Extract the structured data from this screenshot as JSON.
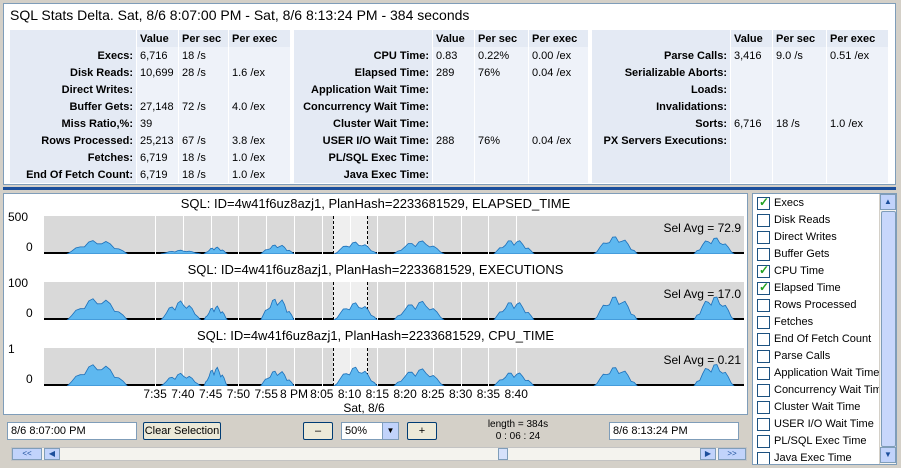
{
  "header": {
    "title": "SQL Stats Delta. Sat, 8/6 8:07:00 PM - Sat, 8/6 8:13:24 PM - 384 seconds"
  },
  "stats": {
    "col_headers": [
      "Value",
      "Per sec",
      "Per exec"
    ],
    "group1": [
      {
        "label": "Execs:",
        "value": "6,716",
        "per_sec": "18 /s",
        "per_exec": ""
      },
      {
        "label": "Disk Reads:",
        "value": "10,699",
        "per_sec": "28 /s",
        "per_exec": "1.6 /ex"
      },
      {
        "label": "Direct Writes:",
        "value": "",
        "per_sec": "",
        "per_exec": ""
      },
      {
        "label": "Buffer Gets:",
        "value": "27,148",
        "per_sec": "72 /s",
        "per_exec": "4.0 /ex"
      },
      {
        "label": "Miss Ratio,%:",
        "value": "39",
        "per_sec": "",
        "per_exec": ""
      },
      {
        "label": "Rows Processed:",
        "value": "25,213",
        "per_sec": "67 /s",
        "per_exec": "3.8 /ex"
      },
      {
        "label": "Fetches:",
        "value": "6,719",
        "per_sec": "18 /s",
        "per_exec": "1.0 /ex"
      },
      {
        "label": "End Of Fetch Count:",
        "value": "6,719",
        "per_sec": "18 /s",
        "per_exec": "1.0 /ex"
      }
    ],
    "group2": [
      {
        "label": "CPU Time:",
        "value": "0.83",
        "per_sec": "0.22%",
        "per_exec": "0.00 /ex"
      },
      {
        "label": "Elapsed Time:",
        "value": "289",
        "per_sec": "76%",
        "per_exec": "0.04 /ex"
      },
      {
        "label": "Application Wait Time:",
        "value": "",
        "per_sec": "",
        "per_exec": ""
      },
      {
        "label": "Concurrency Wait Time:",
        "value": "",
        "per_sec": "",
        "per_exec": ""
      },
      {
        "label": "Cluster Wait Time:",
        "value": "",
        "per_sec": "",
        "per_exec": ""
      },
      {
        "label": "USER I/O Wait Time:",
        "value": "288",
        "per_sec": "76%",
        "per_exec": "0.04 /ex"
      },
      {
        "label": "PL/SQL Exec Time:",
        "value": "",
        "per_sec": "",
        "per_exec": ""
      },
      {
        "label": "Java Exec Time:",
        "value": "",
        "per_sec": "",
        "per_exec": ""
      }
    ],
    "group3": [
      {
        "label": "Parse Calls:",
        "value": "3,416",
        "per_sec": "9.0 /s",
        "per_exec": "0.51 /ex"
      },
      {
        "label": "Serializable Aborts:",
        "value": "",
        "per_sec": "",
        "per_exec": ""
      },
      {
        "label": "Loads:",
        "value": "",
        "per_sec": "",
        "per_exec": ""
      },
      {
        "label": "Invalidations:",
        "value": "",
        "per_sec": "",
        "per_exec": ""
      },
      {
        "label": "Sorts:",
        "value": "6,716",
        "per_sec": "18 /s",
        "per_exec": "1.0 /ex"
      },
      {
        "label": "PX Servers Executions:",
        "value": "",
        "per_sec": "",
        "per_exec": ""
      },
      {
        "label": "",
        "value": "",
        "per_sec": "",
        "per_exec": ""
      },
      {
        "label": "",
        "value": "",
        "per_sec": "",
        "per_exec": ""
      }
    ]
  },
  "chart_data": [
    {
      "type": "area",
      "title": "SQL: ID=4w41f6uz8azj1, PlanHash=2233681529, ELAPSED_TIME",
      "yticks": [
        "500",
        "0"
      ],
      "ylim": [
        0,
        500
      ],
      "sel_avg": "Sel Avg = 72.9",
      "bursts": [
        [
          7.32,
          7.5,
          220
        ],
        [
          7.6,
          7.72,
          60
        ],
        [
          7.73,
          7.8,
          110
        ],
        [
          7.9,
          8.0,
          150
        ],
        [
          8.12,
          8.25,
          190
        ],
        [
          8.3,
          8.45,
          210
        ],
        [
          8.6,
          8.72,
          230
        ],
        [
          8.9,
          9.03,
          280
        ],
        [
          9.2,
          9.32,
          260
        ]
      ]
    },
    {
      "type": "area",
      "title": "SQL: ID=4w41f6uz8azj1, PlanHash=2233681529, EXECUTIONS",
      "yticks": [
        "100",
        "0"
      ],
      "ylim": [
        0,
        100
      ],
      "sel_avg": "Sel Avg = 17.0",
      "bursts": [
        [
          7.32,
          7.5,
          70
        ],
        [
          7.6,
          7.72,
          60
        ],
        [
          7.73,
          7.8,
          45
        ],
        [
          7.9,
          8.0,
          70
        ],
        [
          8.12,
          8.25,
          55
        ],
        [
          8.3,
          8.45,
          60
        ],
        [
          8.6,
          8.72,
          60
        ],
        [
          8.9,
          9.03,
          75
        ],
        [
          9.2,
          9.32,
          75
        ]
      ]
    },
    {
      "type": "area",
      "title": "SQL: ID=4w41f6uz8azj1, PlanHash=2233681529, CPU_TIME",
      "yticks": [
        "1",
        "0"
      ],
      "ylim": [
        0,
        1
      ],
      "sel_avg": "Sel Avg = 0.21",
      "bursts": [
        [
          7.32,
          7.5,
          0.7
        ],
        [
          7.6,
          7.72,
          0.4
        ],
        [
          7.73,
          7.8,
          0.6
        ],
        [
          7.9,
          8.0,
          0.5
        ],
        [
          8.12,
          8.25,
          0.6
        ],
        [
          8.3,
          8.45,
          0.55
        ],
        [
          8.6,
          8.72,
          0.45
        ],
        [
          8.9,
          9.03,
          0.6
        ],
        [
          9.2,
          9.32,
          0.7
        ]
      ]
    }
  ],
  "xaxis": {
    "ticks": [
      "7:35",
      "7:40",
      "7:45",
      "7:50",
      "7:55",
      "8 PM",
      "8:05",
      "8:10",
      "8:15",
      "8:20",
      "8:25",
      "8:30",
      "8:35",
      "8:40"
    ],
    "date": "Sat, 8/6"
  },
  "selection": {
    "start": "8/6 8:07:00 PM",
    "end": "8/6 8:13:24 PM",
    "length": "length = 384s",
    "duration": "0 : 06 : 24"
  },
  "toolbar": {
    "clear_label": "Clear Selection",
    "minus_label": "–",
    "plus_label": "+",
    "zoom": "50%"
  },
  "side_list": [
    {
      "label": "Execs",
      "checked": true
    },
    {
      "label": "Disk Reads",
      "checked": false
    },
    {
      "label": "Direct Writes",
      "checked": false
    },
    {
      "label": "Buffer Gets",
      "checked": false
    },
    {
      "label": "CPU Time",
      "checked": true
    },
    {
      "label": "Elapsed Time",
      "checked": true
    },
    {
      "label": "Rows Processed",
      "checked": false
    },
    {
      "label": "Fetches",
      "checked": false
    },
    {
      "label": "End Of Fetch Count",
      "checked": false
    },
    {
      "label": "Parse Calls",
      "checked": false
    },
    {
      "label": "Application Wait Time",
      "checked": false
    },
    {
      "label": "Concurrency Wait Time",
      "checked": false
    },
    {
      "label": "Cluster Wait Time",
      "checked": false
    },
    {
      "label": "USER I/O Wait Time",
      "checked": false
    },
    {
      "label": "PL/SQL Exec Time",
      "checked": false
    },
    {
      "label": "Java Exec Time",
      "checked": false
    }
  ],
  "colors": {
    "fill": "#5eb8f0",
    "stroke": "#1d6fb8",
    "bg": "#d9d9d9"
  }
}
